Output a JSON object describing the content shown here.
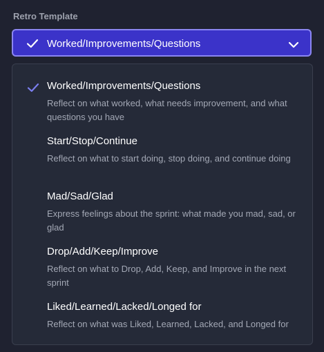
{
  "field": {
    "label": "Retro Template"
  },
  "select": {
    "selected_value": "Worked/Improvements/Questions"
  },
  "icons": {
    "selected_check": "check-icon",
    "dropdown": "chevron-down-icon"
  },
  "colors": {
    "select_bg": "#3b33c9",
    "select_border": "#8b86f2",
    "check_accent": "#7b7ff0"
  },
  "options": [
    {
      "title": "Worked/Improvements/Questions",
      "description": "Reflect on what worked, what needs improvement, and what questions you have",
      "selected": true
    },
    {
      "title": "Start/Stop/Continue",
      "description": "Reflect on what to start doing, stop doing, and continue doing",
      "selected": false
    },
    {
      "title": "Mad/Sad/Glad",
      "description": "Express feelings about the sprint: what made you mad, sad, or glad",
      "selected": false
    },
    {
      "title": "Drop/Add/Keep/Improve",
      "description": "Reflect on what to Drop, Add, Keep, and Improve in the next sprint",
      "selected": false
    },
    {
      "title": "Liked/Learned/Lacked/Longed for",
      "description": "Reflect on what was Liked, Learned, Lacked, and Longed for",
      "selected": false
    }
  ]
}
